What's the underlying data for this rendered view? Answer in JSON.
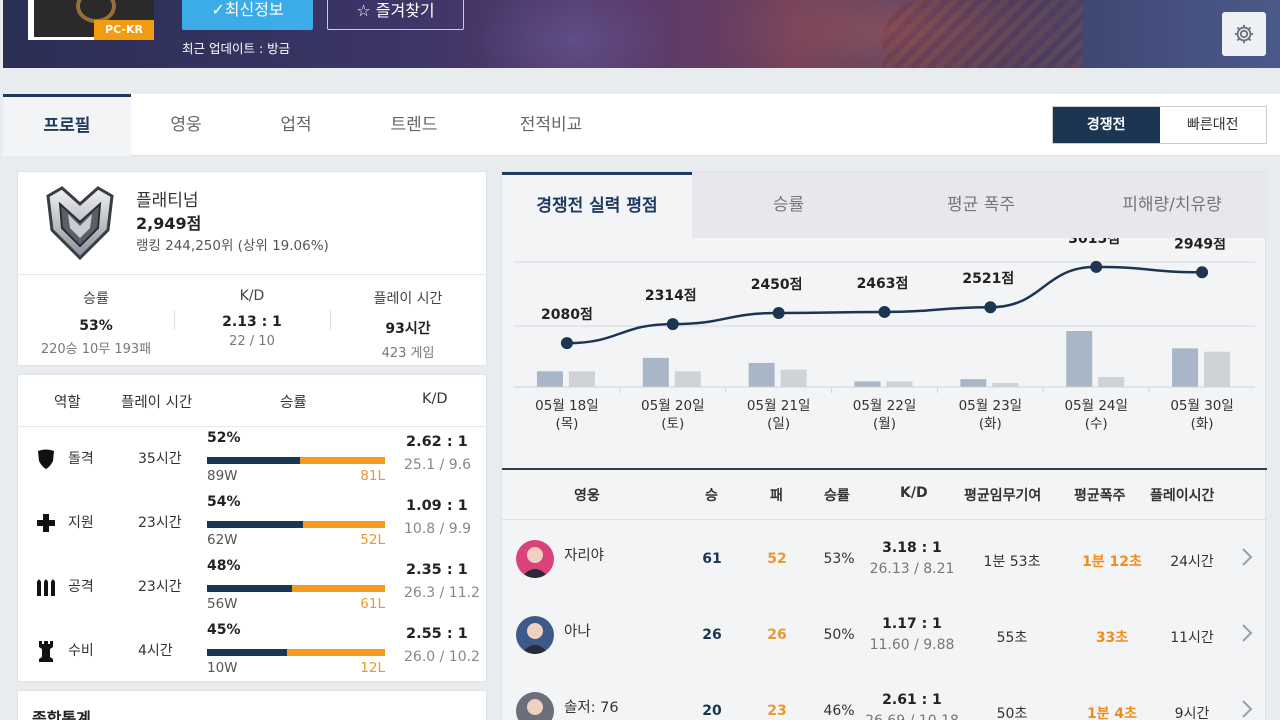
{
  "header": {
    "region": "PC-KR",
    "update_button": "✓최신정보",
    "favorite_button": "즐겨찾기",
    "last_update": "최근 업데이트 : 방금"
  },
  "tabs": [
    {
      "label": "프로필",
      "active": true
    },
    {
      "label": "영웅",
      "active": false
    },
    {
      "label": "업적",
      "active": false
    },
    {
      "label": "트렌드",
      "active": false
    },
    {
      "label": "전적비교",
      "active": false
    }
  ],
  "mode_switch": {
    "competitive": "경쟁전",
    "quickplay": "빠른대전",
    "selected": "competitive"
  },
  "rank": {
    "tier": "플래티넘",
    "score": "2,949점",
    "ranking": "랭킹 244,250위 (상위 19.06%)",
    "stats": [
      {
        "label": "승률",
        "value": "53%",
        "sub": "220승 10무 193패"
      },
      {
        "label": "K/D",
        "value": "2.13 : 1",
        "sub": "22 / 10"
      },
      {
        "label": "플레이 시간",
        "value": "93시간",
        "sub": "423 게임"
      }
    ]
  },
  "roles": {
    "headers": [
      "역할",
      "플레이 시간",
      "승률",
      "K/D"
    ],
    "rows": [
      {
        "icon": "shield-icon",
        "name": "돌격",
        "time": "35시간",
        "winrate": "52%",
        "win_frac": 0.52,
        "wins": "89W",
        "losses": "81L",
        "kd": "2.62 : 1",
        "kd_detail": "25.1 / 9.6"
      },
      {
        "icon": "plus-icon",
        "name": "지원",
        "time": "23시간",
        "winrate": "54%",
        "win_frac": 0.54,
        "wins": "62W",
        "losses": "52L",
        "kd": "1.09 : 1",
        "kd_detail": "10.8 / 9.9"
      },
      {
        "icon": "bullets-icon",
        "name": "공격",
        "time": "23시간",
        "winrate": "48%",
        "win_frac": 0.48,
        "wins": "56W",
        "losses": "61L",
        "kd": "2.35 : 1",
        "kd_detail": "26.3 / 11.2"
      },
      {
        "icon": "tower-icon",
        "name": "수비",
        "time": "4시간",
        "winrate": "45%",
        "win_frac": 0.45,
        "wins": "10W",
        "losses": "12L",
        "kd": "2.55 : 1",
        "kd_detail": "26.0 / 10.2"
      }
    ]
  },
  "total_stats_title": "종합통계",
  "sub_tabs": [
    {
      "label": "경쟁전 실력 평점",
      "active": true
    },
    {
      "label": "승률",
      "active": false
    },
    {
      "label": "평균 폭주",
      "active": false
    },
    {
      "label": "피해량/치유량",
      "active": false
    }
  ],
  "chart_data": {
    "type": "line",
    "categories": [
      "05월 18일",
      "05월 20일",
      "05월 21일",
      "05월 22일",
      "05월 23일",
      "05월 24일",
      "05월 30일"
    ],
    "weekdays": [
      "(목)",
      "(토)",
      "(일)",
      "(월)",
      "(화)",
      "(수)",
      "(화)"
    ],
    "series": [
      {
        "values": [
          2080,
          2314,
          2450,
          2463,
          2521,
          3015,
          2949
        ]
      }
    ],
    "point_labels": [
      "2080점",
      "2314점",
      "2450점",
      "2463점",
      "2521점",
      "3015점",
      "2949점"
    ],
    "bars_a": [
      0.28,
      0.52,
      0.43,
      0.1,
      0.14,
      1.0,
      0.69
    ],
    "bars_b": [
      0.28,
      0.28,
      0.31,
      0.1,
      0.07,
      0.18,
      0.63
    ],
    "colors": {
      "line": "#1c3552",
      "bar_a": "#a9b6c8",
      "bar_b": "#cfd2d6"
    }
  },
  "heroes": {
    "headers": [
      "영웅",
      "승",
      "패",
      "승률",
      "K/D",
      "평균임무기여",
      "평균폭주",
      "플레이시간"
    ],
    "rows": [
      {
        "name": "자리야",
        "wins": "61",
        "losses": "52",
        "winrate": "53%",
        "kd": "3.18 : 1",
        "kd_detail": "26.13 / 8.21",
        "objective": "1분 53초",
        "onfire": "1분 12초",
        "time": "24시간",
        "color": "#d9437a"
      },
      {
        "name": "아나",
        "wins": "26",
        "losses": "26",
        "winrate": "50%",
        "kd": "1.17 : 1",
        "kd_detail": "11.60 / 9.88",
        "objective": "55초",
        "onfire": "33초",
        "time": "11시간",
        "color": "#3b5a8a"
      },
      {
        "name": "솔저: 76",
        "wins": "20",
        "losses": "23",
        "winrate": "46%",
        "kd": "2.61 : 1",
        "kd_detail": "26.69 / 10.18",
        "objective": "50초",
        "onfire": "1분 4초",
        "time": "9시간",
        "color": "#6a6f7a"
      }
    ]
  }
}
